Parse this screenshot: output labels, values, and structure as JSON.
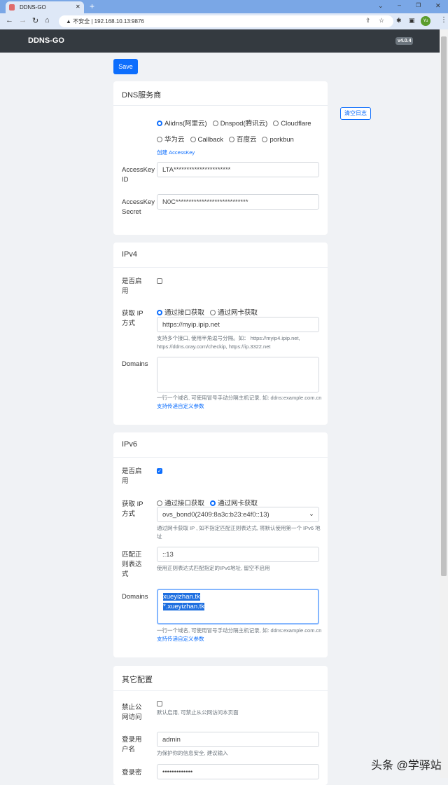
{
  "browser": {
    "tab_title": "DDNS-GO",
    "security": "不安全",
    "url": "192.168.10.13:9876",
    "profile": "Yu"
  },
  "navbar": {
    "brand": "DDNS-GO",
    "version": "v4.0.4"
  },
  "save_label": "Save",
  "clear_log_label": "清空日志",
  "dns": {
    "title": "DNS服务商",
    "providers": [
      "Alidns(阿里云)",
      "Dnspod(腾讯云)",
      "Cloudflare",
      "华为云",
      "Callback",
      "百度云",
      "porkbun"
    ],
    "selected": "Alidns(阿里云)",
    "create_key_link": "创建 AccessKey",
    "id_label": "AccessKey ID",
    "id_value": "LTA**********************",
    "secret_label": "AccessKey Secret",
    "secret_value": "N0C****************************"
  },
  "ipv4": {
    "title": "IPv4",
    "enable_label": "是否启用",
    "enabled": false,
    "method_label": "获取 IP 方式",
    "methods": [
      "通过接口获取",
      "通过网卡获取"
    ],
    "selected_method": "通过接口获取",
    "url_value": "https://myip.ipip.net",
    "url_help": "支持多个接口, 使用半角逗号分隔。如： https://myip4.ipip.net, https://ddns.oray.com/checkip, https://ip.3322.net",
    "domains_label": "Domains",
    "domains_value": "",
    "domains_help": "一行一个域名, 可使用冒号手动分隔主机记录, 如: ddns:example.com.cn",
    "domains_help_link": "支持传递自定义参数"
  },
  "ipv6": {
    "title": "IPv6",
    "enable_label": "是否启用",
    "enabled": true,
    "method_label": "获取 IP 方式",
    "methods": [
      "通过接口获取",
      "通过网卡获取"
    ],
    "selected_method": "通过网卡获取",
    "interface_value": "ovs_bond0(2409:8a3c:b23:e4f0::13)",
    "interface_help": "通过网卡获取 IP , 如不指定匹配正则表达式, 将默认使用第一个 IPv6 地址",
    "regex_label": "匹配正则表达式",
    "regex_value": "::13",
    "regex_help": "使用正则表达式匹配指定的IPv6地址, 留空不启用",
    "domains_label": "Domains",
    "domains_lines": [
      "xueyizhan.tk",
      "*.xueyizhan.tk"
    ],
    "domains_help": "一行一个域名, 可使用冒号手动分隔主机记录, 如: ddns:example.com.cn",
    "domains_help_link": "支持传递自定义参数"
  },
  "other": {
    "title": "其它配置",
    "public_label": "禁止公网访问",
    "public_checked": false,
    "public_help": "默认启用, 可禁止从公网访问本页面",
    "user_label": "登录用户名",
    "user_value": "admin",
    "user_help": "为保护你的信息安全, 建议输入",
    "pass_label": "登录密",
    "pass_value": "•••••••••••••"
  },
  "watermark": "头条 @学驿站"
}
